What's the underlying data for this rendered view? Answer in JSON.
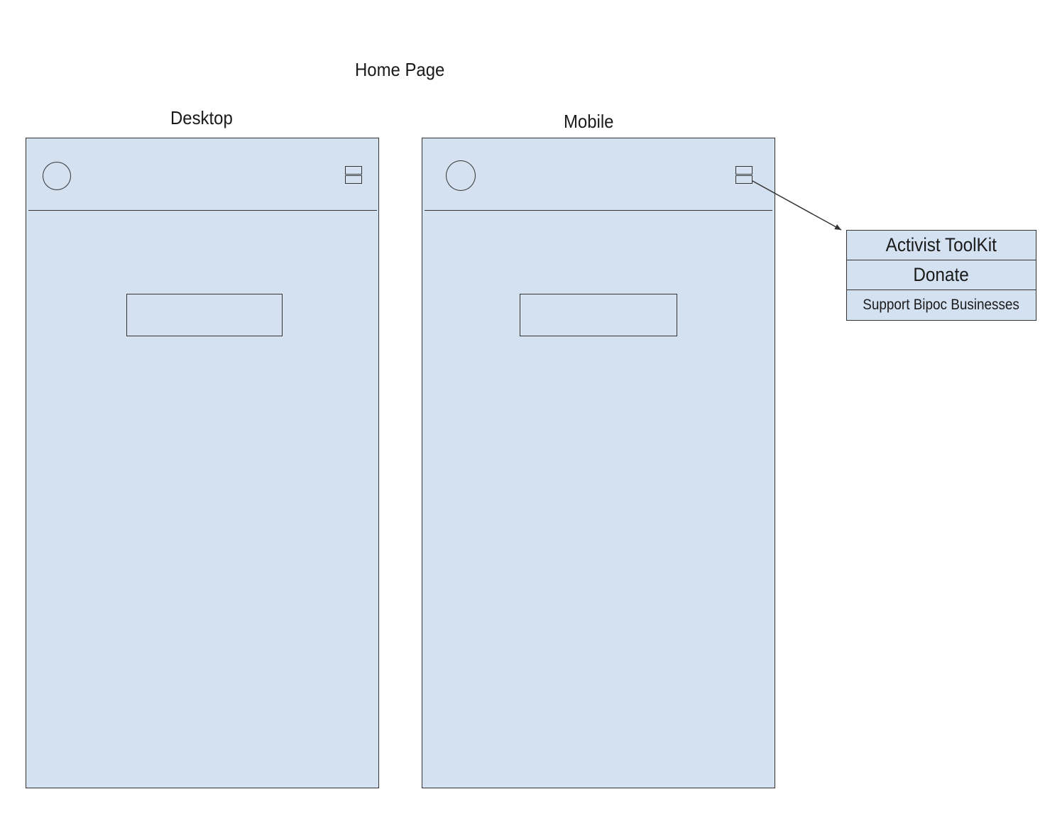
{
  "diagram": {
    "title": "Home Page",
    "desktop": {
      "label": "Desktop"
    },
    "mobile": {
      "label": "Mobile"
    },
    "menu": {
      "items": [
        {
          "label": "Activist ToolKit"
        },
        {
          "label": "Donate"
        },
        {
          "label": "Support Bipoc Businesses"
        }
      ]
    }
  },
  "colors": {
    "frame_fill": "#d4e1f0",
    "stroke": "#333333",
    "background": "#ffffff"
  },
  "icons": {
    "logo": "logo-circle-icon",
    "menu": "hamburger-menu-icon"
  }
}
